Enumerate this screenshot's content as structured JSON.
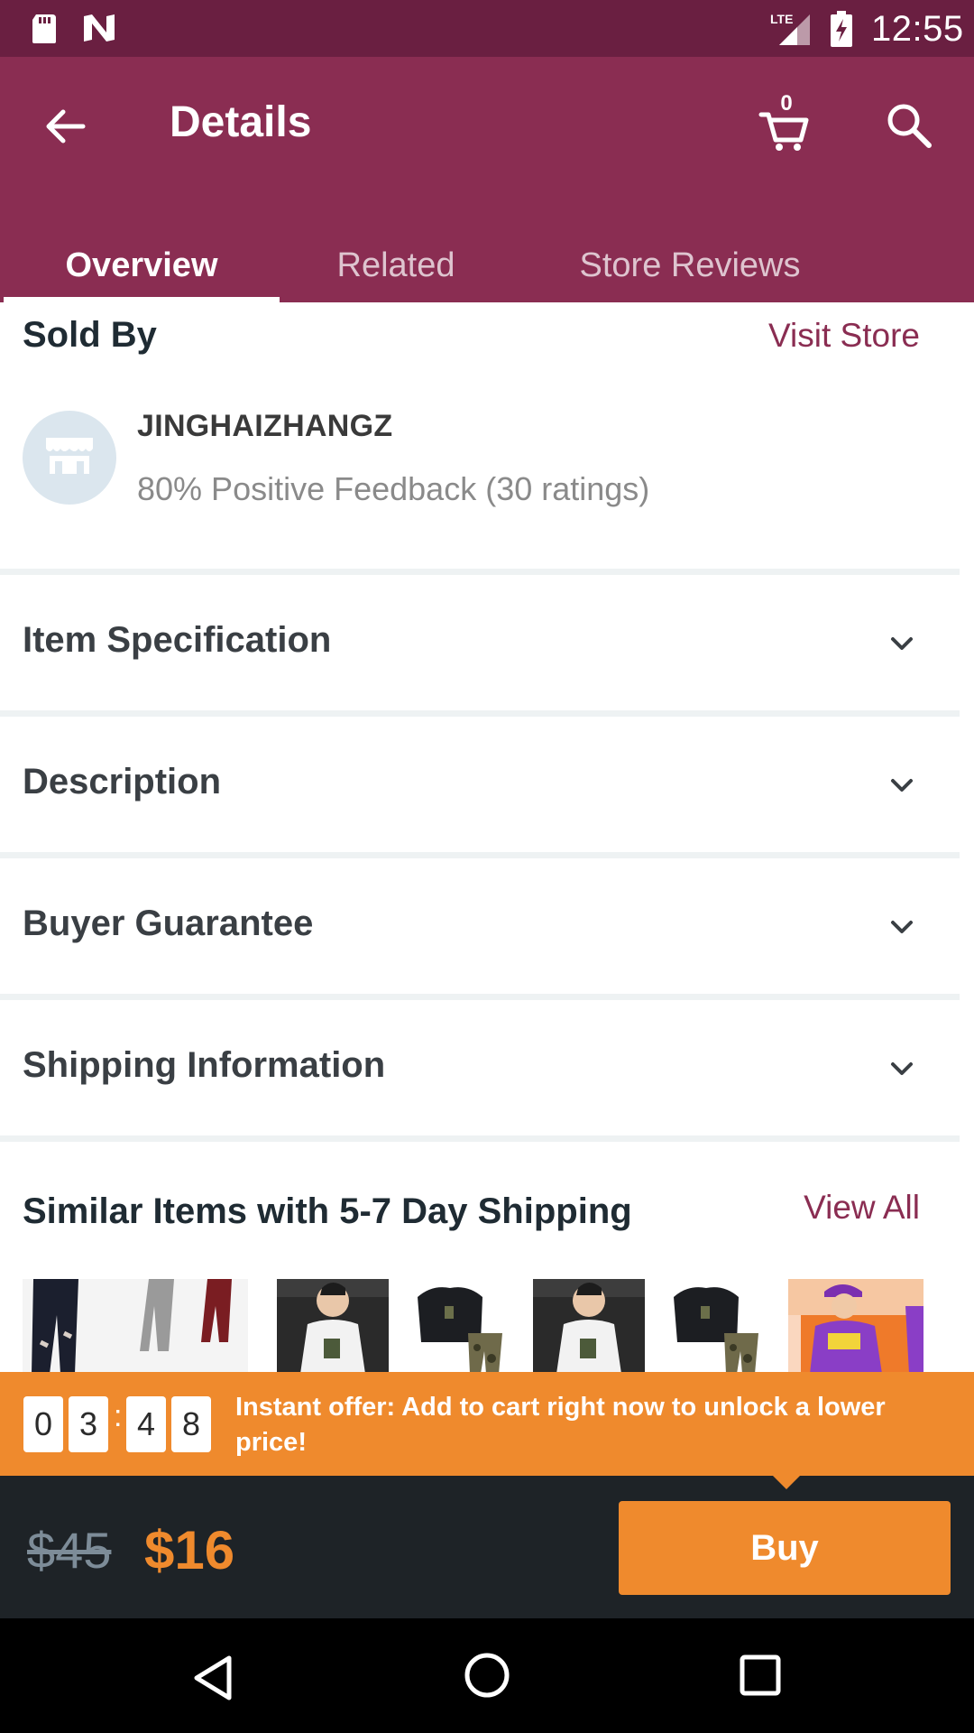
{
  "status_bar": {
    "time": "12:55",
    "network": "LTE"
  },
  "header": {
    "title": "Details",
    "cart_count": "0"
  },
  "tabs": [
    {
      "label": "Overview",
      "active": true
    },
    {
      "label": "Related",
      "active": false
    },
    {
      "label": "Store Reviews",
      "active": false
    }
  ],
  "seller": {
    "section_title": "Sold By",
    "visit_store_label": "Visit Store",
    "store_name": "JINGHAIZHANGZ",
    "feedback": "80% Positive Feedback (30 ratings)"
  },
  "sections": [
    {
      "label": "Item Specification"
    },
    {
      "label": "Description"
    },
    {
      "label": "Buyer Guarantee"
    },
    {
      "label": "Shipping Information"
    }
  ],
  "similar": {
    "title": "Similar Items with 5-7 Day Shipping",
    "view_all_label": "View All"
  },
  "offer": {
    "timer_digits": [
      "0",
      "3",
      "4",
      "8"
    ],
    "separator": ":",
    "text": "Instant offer: Add to cart right now to unlock a lower price!"
  },
  "pricing": {
    "old_price": "$45",
    "new_price": "$16",
    "buy_label": "Buy"
  },
  "colors": {
    "primary": "#8a2d52",
    "status_bar": "#6a1f41",
    "accent": "#ef8a2d",
    "footer": "#1e2327"
  }
}
